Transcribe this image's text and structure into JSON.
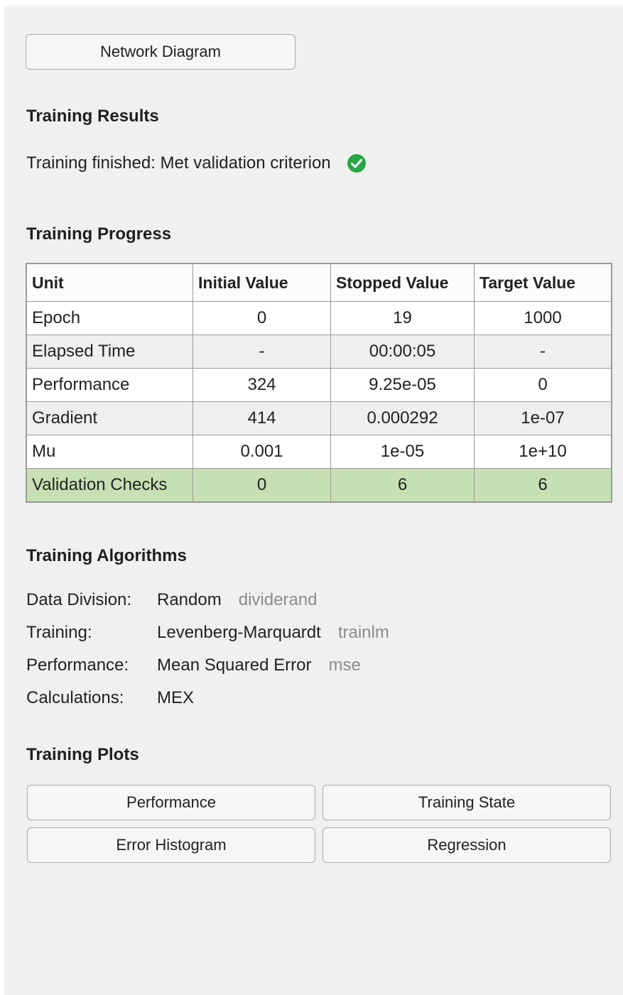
{
  "network_button": {
    "label": "Network Diagram"
  },
  "results": {
    "heading": "Training Results",
    "status": "Training finished: Met validation criterion",
    "status_icon": "check-circle-icon",
    "status_color": "#27a844"
  },
  "progress": {
    "heading": "Training Progress",
    "columns": [
      "Unit",
      "Initial Value",
      "Stopped Value",
      "Target Value"
    ],
    "rows": [
      {
        "unit": "Epoch",
        "initial": "0",
        "stopped": "19",
        "target": "1000"
      },
      {
        "unit": "Elapsed Time",
        "initial": "-",
        "stopped": "00:00:05",
        "target": "-"
      },
      {
        "unit": "Performance",
        "initial": "324",
        "stopped": "9.25e-05",
        "target": "0"
      },
      {
        "unit": "Gradient",
        "initial": "414",
        "stopped": "0.000292",
        "target": "1e-07"
      },
      {
        "unit": "Mu",
        "initial": "0.001",
        "stopped": "1e-05",
        "target": "1e+10"
      },
      {
        "unit": "Validation Checks",
        "initial": "0",
        "stopped": "6",
        "target": "6"
      }
    ],
    "highlight_color": "#c6e0b4"
  },
  "algorithms": {
    "heading": "Training Algorithms",
    "items": [
      {
        "label": "Data Division:",
        "value": "Random",
        "function": "dividerand"
      },
      {
        "label": "Training:",
        "value": "Levenberg-Marquardt",
        "function": "trainlm"
      },
      {
        "label": "Performance:",
        "value": "Mean Squared Error",
        "function": "mse"
      },
      {
        "label": "Calculations:",
        "value": "MEX",
        "function": ""
      }
    ]
  },
  "plots": {
    "heading": "Training Plots",
    "buttons": [
      "Performance",
      "Training State",
      "Error Histogram",
      "Regression"
    ]
  }
}
